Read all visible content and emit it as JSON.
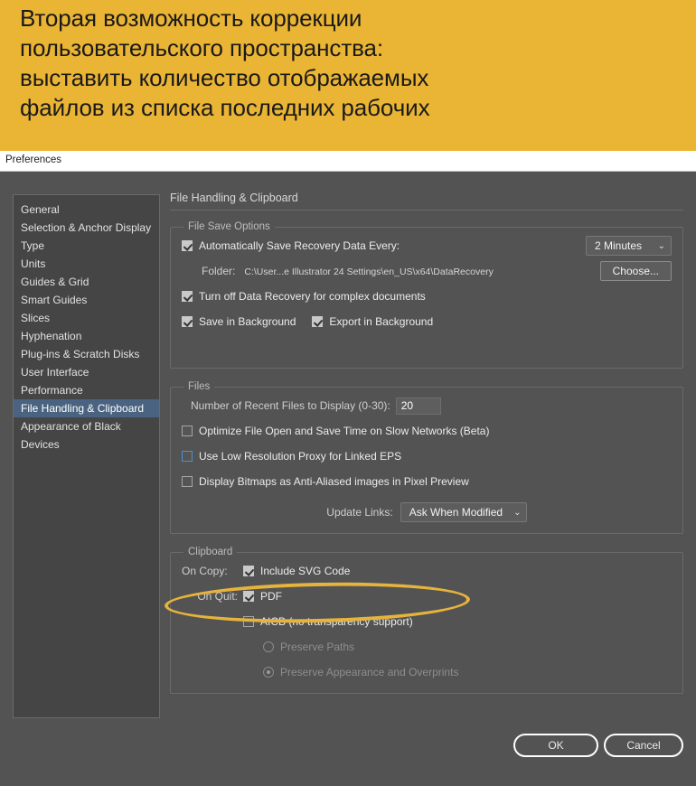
{
  "banner": {
    "lines": [
      "Вторая возможность коррекции",
      "пользовательского пространства:",
      "выставить количество отображаемых",
      "файлов из списка последних рабочих"
    ],
    "background_color": "#eab434"
  },
  "titlebar": {
    "title": "Preferences"
  },
  "sidebar": {
    "items": [
      {
        "label": "General",
        "selected": false
      },
      {
        "label": "Selection & Anchor Display",
        "selected": false
      },
      {
        "label": "Type",
        "selected": false
      },
      {
        "label": "Units",
        "selected": false
      },
      {
        "label": "Guides & Grid",
        "selected": false
      },
      {
        "label": "Smart Guides",
        "selected": false
      },
      {
        "label": "Slices",
        "selected": false
      },
      {
        "label": "Hyphenation",
        "selected": false
      },
      {
        "label": "Plug-ins & Scratch Disks",
        "selected": false
      },
      {
        "label": "User Interface",
        "selected": false
      },
      {
        "label": "Performance",
        "selected": false
      },
      {
        "label": "File Handling & Clipboard",
        "selected": true
      },
      {
        "label": "Appearance of Black",
        "selected": false
      },
      {
        "label": "Devices",
        "selected": false
      }
    ],
    "selected_color": "#4a6380"
  },
  "panel": {
    "heading": "File Handling & Clipboard",
    "file_save_options": {
      "legend": "File Save Options",
      "auto_save_label": "Automatically Save Recovery Data Every:",
      "auto_save_checked": true,
      "interval_value": "2 Minutes",
      "folder_label": "Folder:",
      "folder_path": "C:\\User...e Illustrator 24 Settings\\en_US\\x64\\DataRecovery",
      "choose_button": "Choose...",
      "turn_off_label": "Turn off Data Recovery for complex documents",
      "turn_off_checked": true,
      "save_bg_label": "Save in Background",
      "save_bg_checked": true,
      "export_bg_label": "Export in Background",
      "export_bg_checked": true
    },
    "files": {
      "legend": "Files",
      "recent_files_label": "Number of Recent Files to Display (0-30):",
      "recent_files_value": "20",
      "optimize_label": "Optimize File Open and Save Time on Slow Networks (Beta)",
      "optimize_checked": false,
      "low_res_label": "Use Low Resolution Proxy for Linked EPS",
      "low_res_checked": false,
      "low_res_focused": true,
      "bitmaps_label": "Display Bitmaps as Anti-Aliased images in Pixel Preview",
      "bitmaps_checked": false,
      "update_links_label": "Update Links:",
      "update_links_value": "Ask When Modified"
    },
    "clipboard": {
      "legend": "Clipboard",
      "on_copy_label": "On Copy:",
      "include_svg_label": "Include SVG Code",
      "include_svg_checked": true,
      "on_quit_label": "On Quit:",
      "pdf_label": "PDF",
      "pdf_checked": true,
      "aicb_label": "AICB (no transparency support)",
      "aicb_checked": false,
      "preserve_paths_label": "Preserve Paths",
      "preserve_paths_selected": false,
      "preserve_appearance_label": "Preserve Appearance and Overprints",
      "preserve_appearance_selected": true
    }
  },
  "footer": {
    "ok_label": "OK",
    "cancel_label": "Cancel"
  },
  "annotation": {
    "highlight_color": "#e6b33c"
  }
}
